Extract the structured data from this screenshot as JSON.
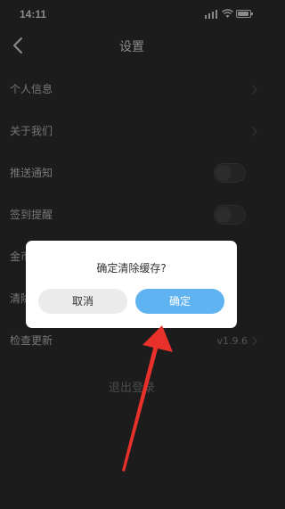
{
  "status_bar": {
    "time": "14:11"
  },
  "nav": {
    "title": "设置",
    "back_icon": "chevron-left-icon"
  },
  "settings": {
    "items": [
      {
        "label": "个人信息",
        "control": "chevron"
      },
      {
        "label": "关于我们",
        "control": "chevron"
      },
      {
        "label": "推送通知",
        "control": "toggle",
        "enabled": false
      },
      {
        "label": "签到提醒",
        "control": "toggle",
        "enabled": false
      },
      {
        "label": "金币",
        "control": "none"
      },
      {
        "label": "清除",
        "control": "none"
      },
      {
        "label": "检查更新",
        "control": "version",
        "value": "v1.9.6"
      }
    ],
    "logout_label": "退出登录"
  },
  "dialog": {
    "message": "确定清除缓存?",
    "cancel_label": "取消",
    "confirm_label": "确定",
    "confirm_color": "#5fb3f0",
    "cancel_color": "#ececec"
  },
  "annotation": {
    "arrow_color": "#e8312a",
    "points_to": "confirm-button"
  }
}
